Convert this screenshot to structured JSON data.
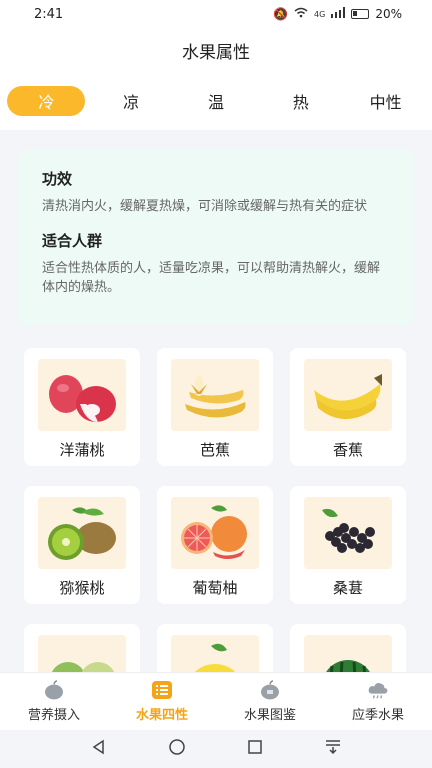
{
  "status": {
    "time": "2:41",
    "network": "4G",
    "battery": "20%"
  },
  "title": "水果属性",
  "tabs": [
    {
      "label": "冷",
      "active": true
    },
    {
      "label": "凉",
      "active": false
    },
    {
      "label": "温",
      "active": false
    },
    {
      "label": "热",
      "active": false
    },
    {
      "label": "中性",
      "active": false
    }
  ],
  "info": {
    "effect_title": "功效",
    "effect_text": "清热消内火，缓解夏热燥，可消除或缓解与热有关的症状",
    "people_title": "适合人群",
    "people_text": "适合性热体质的人，适量吃凉果，可以帮助清热解火，缓解体内的燥热。"
  },
  "fruits": [
    {
      "name": "洋蒲桃",
      "icon": "wax-apple-icon"
    },
    {
      "name": "芭蕉",
      "icon": "plantain-icon"
    },
    {
      "name": "香蕉",
      "icon": "banana-icon"
    },
    {
      "name": "猕猴桃",
      "icon": "kiwi-icon"
    },
    {
      "name": "葡萄柚",
      "icon": "grapefruit-icon"
    },
    {
      "name": "桑葚",
      "icon": "mulberry-icon"
    },
    {
      "name": "",
      "icon": "melon-icon"
    },
    {
      "name": "",
      "icon": "lemon-icon"
    },
    {
      "name": "",
      "icon": "watermelon-icon"
    }
  ],
  "nav": [
    {
      "label": "营养摄入",
      "icon": "apple-icon",
      "active": false
    },
    {
      "label": "水果四性",
      "icon": "list-icon",
      "active": true
    },
    {
      "label": "水果图鉴",
      "icon": "apple-book-icon",
      "active": false
    },
    {
      "label": "应季水果",
      "icon": "cloud-icon",
      "active": false
    }
  ],
  "colors": {
    "accent": "#fbb82b",
    "card_bg": "#eefaf5",
    "page_bg": "#f4f5f9"
  }
}
